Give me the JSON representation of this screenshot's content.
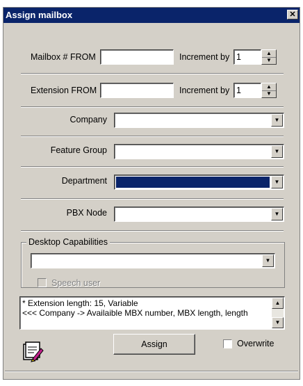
{
  "window": {
    "title": "Assign mailbox",
    "close_label": "✕"
  },
  "mailbox": {
    "label": "Mailbox # FROM",
    "value": "",
    "increment_label": "Increment by",
    "increment_value": "1"
  },
  "extension": {
    "label": "Extension FROM",
    "value": "",
    "increment_label": "Increment by",
    "increment_value": "1"
  },
  "company": {
    "label": "Company",
    "value": ""
  },
  "feature_group": {
    "label": "Feature Group",
    "value": ""
  },
  "department": {
    "label": "Department",
    "value": ""
  },
  "pbx_node": {
    "label": "PBX Node",
    "value": ""
  },
  "desktop": {
    "group_label": "Desktop Capabilities",
    "value": ""
  },
  "speech_user": {
    "label": "Speech user",
    "checked": false,
    "enabled": false
  },
  "info": {
    "line1": "* Extension length: 15, Variable",
    "line2": "<<< Company -> Availaible MBX number, MBX length, length"
  },
  "actions": {
    "assign_label": "Assign",
    "overwrite_label": "Overwrite",
    "overwrite_checked": false
  }
}
